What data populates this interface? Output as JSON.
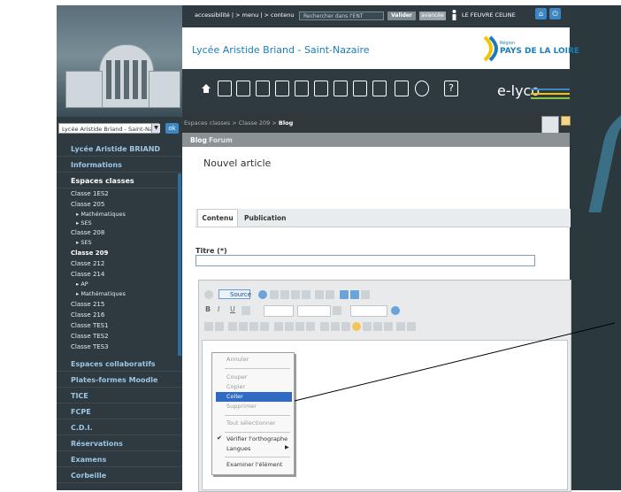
{
  "header": {
    "links": "accessibilité | > menu | > contenu",
    "search_placeholder": "Rechercher dans l'ENT",
    "validate_label": "Valider",
    "advanced_label": "avancée",
    "user_name": "LE FEUVRE CELINE"
  },
  "brand": {
    "school_name": "Lycée Aristide Briand - Saint-Nazaire",
    "region_small": "Région",
    "region_name": "PAYS DE LA LOIRE",
    "platform_name": "e-lyco"
  },
  "sidebar": {
    "school_select": "Lycée Aristide Briand - Saint-Naz",
    "ok_label": "ok",
    "sections": {
      "lycee": "Lycée Aristide BRIAND",
      "informations": "Informations",
      "espaces_classes": "Espaces classes",
      "espaces_collab": "Espaces collaboratifs",
      "moodle": "Plates-formes Moodle",
      "tice": "TICE",
      "fcpe": "FCPE",
      "cdi": "C.D.I.",
      "reservations": "Réservations",
      "examens": "Examens",
      "corbeille": "Corbeille"
    },
    "classes": [
      "Classe 1ES2",
      "Classe 205",
      "▸ Mathématiques",
      "▸ SES",
      "Classe 208",
      "▸ SES",
      "Classe 209",
      "Classe 212",
      "Classe 214",
      "▸ AP",
      "▸ Mathématiques",
      "Classe 215",
      "Classe 216",
      "Classe TES1",
      "Classe TES2",
      "Classe TES3"
    ]
  },
  "breadcrumb": {
    "part1": "Espaces classes",
    "part2": "Classe 209",
    "current": "Blog"
  },
  "tabs": {
    "blog": "Blog",
    "forum": "Forum"
  },
  "main": {
    "page_title": "Nouvel article",
    "subtab_contenu": "Contenu",
    "subtab_publication": "Publication",
    "title_label": "Titre (*)",
    "title_value": ""
  },
  "editor": {
    "source_label": "Source",
    "bold": "B",
    "italic": "I",
    "underline": "U"
  },
  "context_menu": {
    "items": [
      "Annuler",
      "Couper",
      "Copier",
      "Coller",
      "Supprimer",
      "Tout sélectionner",
      "Vérifier l'orthographe",
      "Langues",
      "Examiner l'élément"
    ],
    "selected": "Coller"
  }
}
